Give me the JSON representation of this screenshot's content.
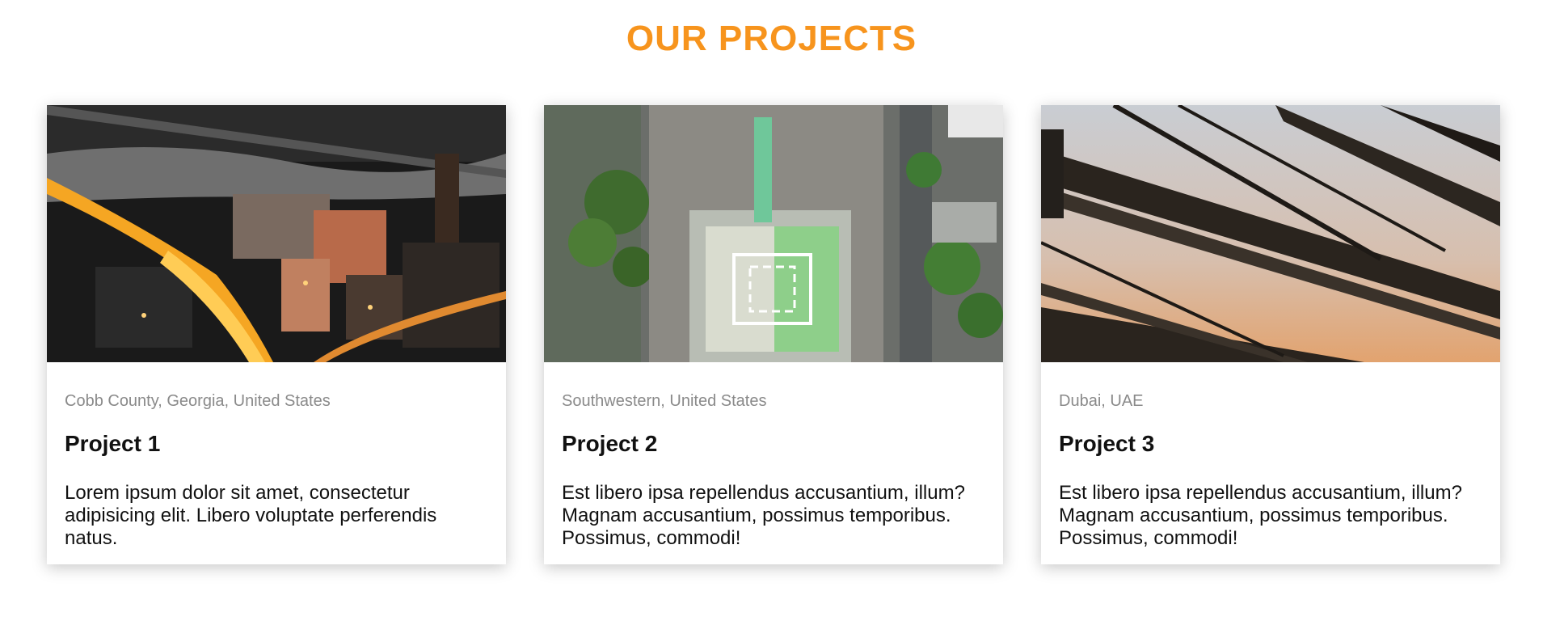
{
  "section": {
    "title": "OUR PROJECTS",
    "accent_color": "#f7941d"
  },
  "projects": [
    {
      "location": "Cobb County, Georgia, United States",
      "title": "Project 1",
      "description": "Lorem ipsum dolor sit amet, consectetur adipisicing elit. Libero voluptate perferendis natus.",
      "image": "city-night-aerial-photo"
    },
    {
      "location": "Southwestern, United States",
      "title": "Project 2",
      "description": "Est libero ipsa repellendus accusantium, illum? Magnam accusantium, possimus temporibus. Possimus, commodi!",
      "image": "rooftop-helipad-aerial-photo"
    },
    {
      "location": "Dubai, UAE",
      "title": "Project 3",
      "description": "Est libero ipsa repellendus accusantium, illum? Magnam accusantium, possimus temporibus. Possimus, commodi!",
      "image": "steel-bridge-sunset-photo"
    }
  ]
}
